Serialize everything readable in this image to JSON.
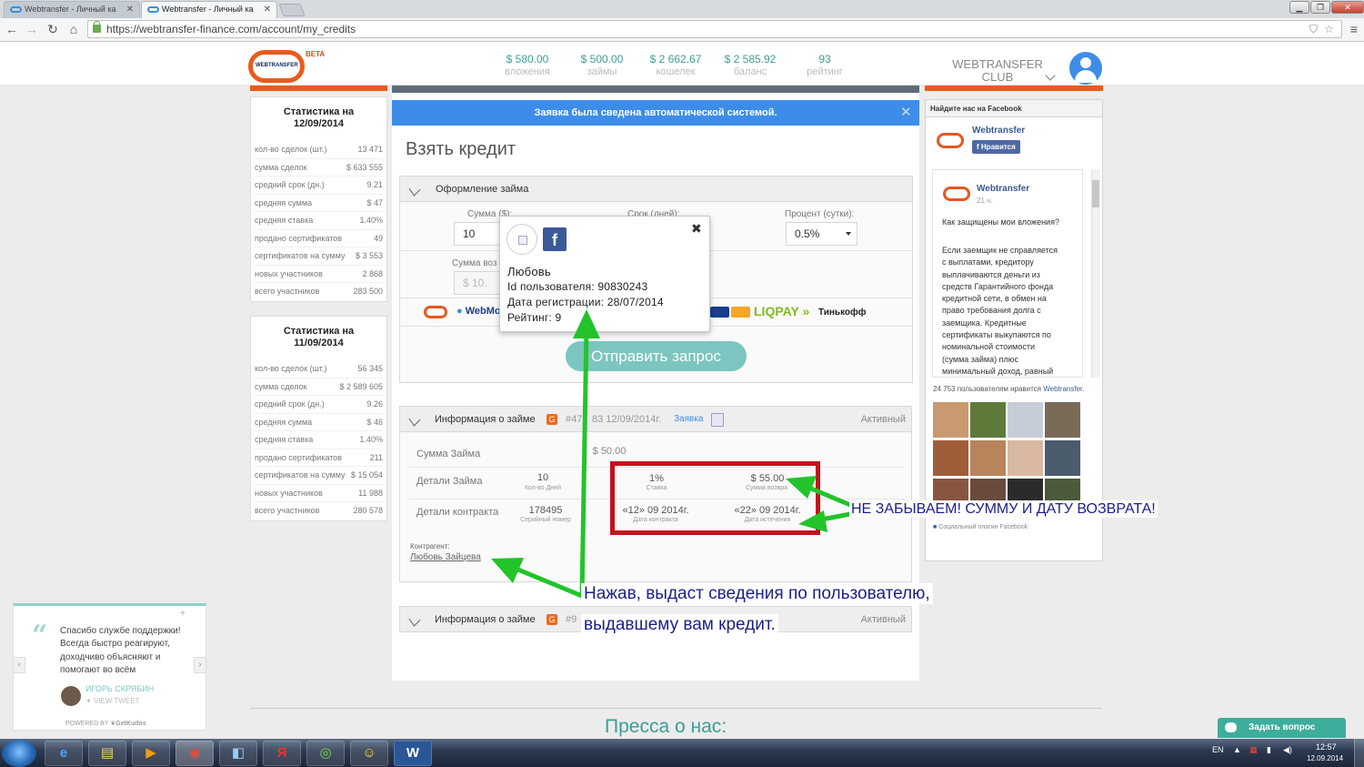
{
  "browser": {
    "tabs": [
      {
        "title": "Webtransfer - Личный ка",
        "active": false
      },
      {
        "title": "Webtransfer - Личный ка",
        "active": true
      }
    ],
    "window_controls": [
      "▁",
      "❐",
      "✕"
    ],
    "url": "https://webtransfer-finance.com/account/my_credits"
  },
  "header": {
    "logo_text": "WEBTRANSFER",
    "beta": "BETA",
    "stats": [
      {
        "value": "$ 580.00",
        "label": "вложения"
      },
      {
        "value": "$ 500.00",
        "label": "займы"
      },
      {
        "value": "$ 2 662.67",
        "label": "кошелек"
      },
      {
        "value": "$ 2 585.92",
        "label": "баланс"
      },
      {
        "value": "93",
        "label": "рейтинг"
      }
    ],
    "club_line1": "WEBTRANSFER",
    "club_line2": "CLUB"
  },
  "stats_panels": [
    {
      "title_line1": "Статистика на",
      "title_line2": "12/09/2014",
      "rows": [
        {
          "label": "кол-во сделок (шт.)",
          "value": "13 471"
        },
        {
          "label": "сумма сделок",
          "value": "$ 633 555"
        },
        {
          "label": "средний срок (дн.)",
          "value": "9.21"
        },
        {
          "label": "средняя сумма",
          "value": "$ 47"
        },
        {
          "label": "средняя ставка",
          "value": "1.40%"
        },
        {
          "label": "продано сертификатов",
          "value": "49"
        },
        {
          "label": "сертификатов на сумму",
          "value": "$ 3 553"
        },
        {
          "label": "новых участников",
          "value": "2 868"
        },
        {
          "label": "всего участников",
          "value": "283 500"
        }
      ]
    },
    {
      "title_line1": "Статистика на",
      "title_line2": "11/09/2014",
      "rows": [
        {
          "label": "кол-во сделок (шт.)",
          "value": "56 345"
        },
        {
          "label": "сумма сделок",
          "value": "$ 2 589 605"
        },
        {
          "label": "средний срок (дн.)",
          "value": "9.26"
        },
        {
          "label": "средняя сумма",
          "value": "$ 46"
        },
        {
          "label": "средняя ставка",
          "value": "1.40%"
        },
        {
          "label": "продано сертификатов",
          "value": "211"
        },
        {
          "label": "сертификатов на сумму",
          "value": "$ 15 054"
        },
        {
          "label": "новых участников",
          "value": "11 988"
        },
        {
          "label": "всего участников",
          "value": "280 578"
        }
      ]
    }
  ],
  "notice": "Заявка была сведена автоматической системой.",
  "page_title": "Взять кредит",
  "loan_form": {
    "header": "Оформление займа",
    "amount_label": "Сумма ($):",
    "amount_value": "10",
    "term_label": "Срок (дней):",
    "percent_label": "Процент (сутки):",
    "percent_value": "0.5%",
    "return_label": "Сумма воз",
    "return_value": "$ 10.",
    "pay_webmoney": "WebMo",
    "pay_liqpay": "LIQPAY",
    "pay_tinkoff": "Тинькофф",
    "send_button": "Отправить запрос"
  },
  "loan_info": {
    "header": "Информация о займе",
    "number": "#47",
    "number_tail": "83 12/09/2014г.",
    "request_link": "Заявка",
    "status": "Активный",
    "sum_label": "Сумма Займа",
    "sum_value": "$ 50.00",
    "details_label": "Детали Займа",
    "days_value": "10",
    "days_sub": "Кол-во Дней",
    "rate_value": "1%",
    "rate_sub": "Ставка",
    "return_value": "$ 55.00",
    "return_sub": "Сумма возвра",
    "contract_label": "Детали контракта",
    "serial_value": "178495",
    "serial_sub": "Серийный номер",
    "contract_date": "«12» 09 2014г.",
    "contract_date_sub": "Дата контракта",
    "expiry_date": "«22» 09 2014г.",
    "expiry_date_sub": "Дата истечения",
    "counterparty_label": "Контрагент:",
    "counterparty_name": "Любовь Зайцева"
  },
  "loan_info2": {
    "header": "Информация о займе",
    "number": "#9",
    "status": "Активный"
  },
  "user_popup": {
    "name": "Любовь",
    "id_line": "Id пользователя: 90830243",
    "reg_line": "Дата регистрации: 28/07/2014",
    "rating_line": "Рейтинг: 9",
    "fb_letter": "f",
    "close": "✖"
  },
  "facebook": {
    "title": "Найдите нас на Facebook",
    "page_name": "Webtransfer",
    "like_button": "Нравится",
    "post_author": "Webtransfer",
    "post_time": "21 ч.",
    "post_question": "Как защищены мои вложения?",
    "post_body": [
      "Если заемщик не справляется",
      "с выплатами, кредитору",
      "выплачиваются деньги из",
      "средств Гарантийного фонда",
      "кредитной сети, в обмен на",
      "право требования долга с",
      "заемщика. Кредитные",
      "сертификаты выкупаются по",
      "номинальной стоимости",
      "(сумма займа) плюс",
      "минимальный доход, равный"
    ],
    "likes_count": "24 753 пользователям нравится",
    "likes_page": "Webtransfer.",
    "plugin_text": "Социальный плагин Facebook"
  },
  "widget": {
    "quote_mark": "“",
    "lines": [
      "Спасибо службе поддержки!",
      "Всегда быстро реагируют,",
      "доходчиво объясняют и",
      "помогают во всём"
    ],
    "author": "ИГОРЬ СКРЯБИН",
    "view_tweet": "VIEW TWEET",
    "powered": "POWERED BY",
    "powered_brand": "GetKudos",
    "plus": "+"
  },
  "annotations": {
    "remember": "НЕ ЗАБЫВАЕМ! СУММУ И ДАТУ ВОЗВРАТА!",
    "click_line1": "Нажав, выдаст сведения по пользователю,",
    "click_line2": "выдавшему вам кредит."
  },
  "footer": {
    "press": "Пресса о нас:",
    "ask_button": "Задать вопрос"
  },
  "taskbar": {
    "lang": "EN",
    "time": "12:57",
    "date": "12.09.2014"
  },
  "colors": {
    "accent": "#ea5a1c",
    "teal": "#3b9e97",
    "notice_blue": "#3d8de8",
    "red_box": "#c5111c",
    "arrow_green": "#22c42a"
  }
}
